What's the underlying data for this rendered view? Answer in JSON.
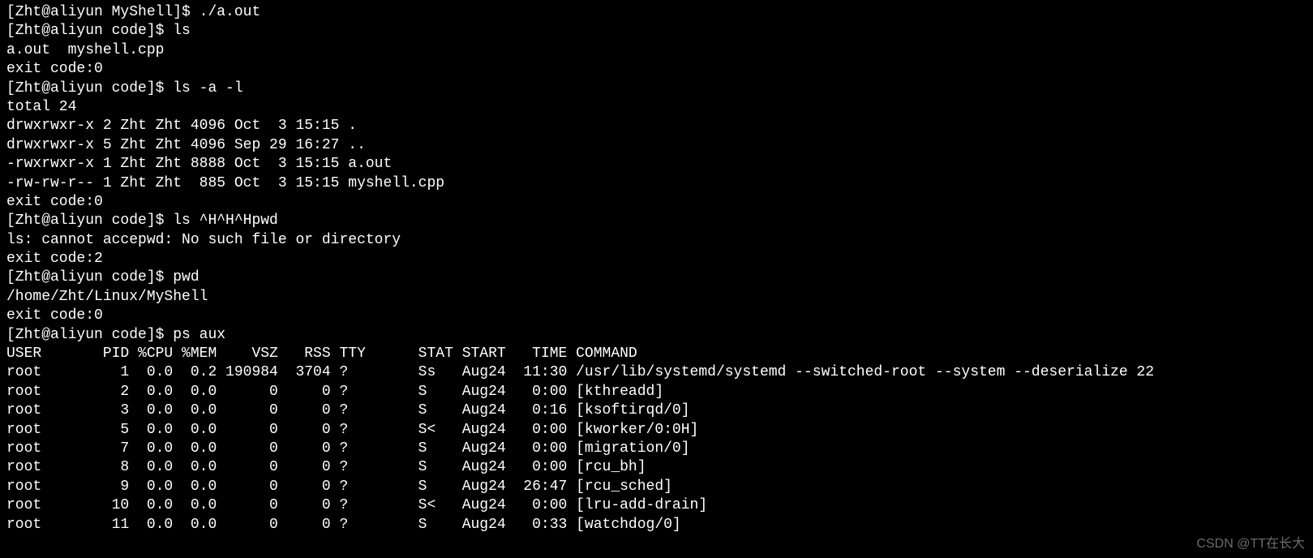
{
  "lines": [
    "[Zht@aliyun MyShell]$ ./a.out",
    "[Zht@aliyun code]$ ls",
    "a.out  myshell.cpp",
    "exit code:0",
    "[Zht@aliyun code]$ ls -a -l",
    "total 24",
    "drwxrwxr-x 2 Zht Zht 4096 Oct  3 15:15 .",
    "drwxrwxr-x 5 Zht Zht 4096 Sep 29 16:27 ..",
    "-rwxrwxr-x 1 Zht Zht 8888 Oct  3 15:15 a.out",
    "-rw-rw-r-- 1 Zht Zht  885 Oct  3 15:15 myshell.cpp",
    "exit code:0",
    "[Zht@aliyun code]$ ls ^H^H^Hpwd",
    "ls: cannot accepwd: No such file or directory",
    "exit code:2",
    "[Zht@aliyun code]$ pwd",
    "/home/Zht/Linux/MyShell",
    "exit code:0",
    "[Zht@aliyun code]$ ps aux",
    "USER       PID %CPU %MEM    VSZ   RSS TTY      STAT START   TIME COMMAND",
    "root         1  0.0  0.2 190984  3704 ?        Ss   Aug24  11:30 /usr/lib/systemd/systemd --switched-root --system --deserialize 22",
    "root         2  0.0  0.0      0     0 ?        S    Aug24   0:00 [kthreadd]",
    "root         3  0.0  0.0      0     0 ?        S    Aug24   0:16 [ksoftirqd/0]",
    "root         5  0.0  0.0      0     0 ?        S<   Aug24   0:00 [kworker/0:0H]",
    "root         7  0.0  0.0      0     0 ?        S    Aug24   0:00 [migration/0]",
    "root         8  0.0  0.0      0     0 ?        S    Aug24   0:00 [rcu_bh]",
    "root         9  0.0  0.0      0     0 ?        S    Aug24  26:47 [rcu_sched]",
    "root        10  0.0  0.0      0     0 ?        S<   Aug24   0:00 [lru-add-drain]",
    "root        11  0.0  0.0      0     0 ?        S    Aug24   0:33 [watchdog/0]"
  ],
  "watermark": "CSDN @TT在长大",
  "ps_data": {
    "headers": [
      "USER",
      "PID",
      "%CPU",
      "%MEM",
      "VSZ",
      "RSS",
      "TTY",
      "STAT",
      "START",
      "TIME",
      "COMMAND"
    ],
    "rows": [
      {
        "USER": "root",
        "PID": 1,
        "%CPU": 0.0,
        "%MEM": 0.2,
        "VSZ": 190984,
        "RSS": 3704,
        "TTY": "?",
        "STAT": "Ss",
        "START": "Aug24",
        "TIME": "11:30",
        "COMMAND": "/usr/lib/systemd/systemd --switched-root --system --deserialize 22"
      },
      {
        "USER": "root",
        "PID": 2,
        "%CPU": 0.0,
        "%MEM": 0.0,
        "VSZ": 0,
        "RSS": 0,
        "TTY": "?",
        "STAT": "S",
        "START": "Aug24",
        "TIME": "0:00",
        "COMMAND": "[kthreadd]"
      },
      {
        "USER": "root",
        "PID": 3,
        "%CPU": 0.0,
        "%MEM": 0.0,
        "VSZ": 0,
        "RSS": 0,
        "TTY": "?",
        "STAT": "S",
        "START": "Aug24",
        "TIME": "0:16",
        "COMMAND": "[ksoftirqd/0]"
      },
      {
        "USER": "root",
        "PID": 5,
        "%CPU": 0.0,
        "%MEM": 0.0,
        "VSZ": 0,
        "RSS": 0,
        "TTY": "?",
        "STAT": "S<",
        "START": "Aug24",
        "TIME": "0:00",
        "COMMAND": "[kworker/0:0H]"
      },
      {
        "USER": "root",
        "PID": 7,
        "%CPU": 0.0,
        "%MEM": 0.0,
        "VSZ": 0,
        "RSS": 0,
        "TTY": "?",
        "STAT": "S",
        "START": "Aug24",
        "TIME": "0:00",
        "COMMAND": "[migration/0]"
      },
      {
        "USER": "root",
        "PID": 8,
        "%CPU": 0.0,
        "%MEM": 0.0,
        "VSZ": 0,
        "RSS": 0,
        "TTY": "?",
        "STAT": "S",
        "START": "Aug24",
        "TIME": "0:00",
        "COMMAND": "[rcu_bh]"
      },
      {
        "USER": "root",
        "PID": 9,
        "%CPU": 0.0,
        "%MEM": 0.0,
        "VSZ": 0,
        "RSS": 0,
        "TTY": "?",
        "STAT": "S",
        "START": "Aug24",
        "TIME": "26:47",
        "COMMAND": "[rcu_sched]"
      },
      {
        "USER": "root",
        "PID": 10,
        "%CPU": 0.0,
        "%MEM": 0.0,
        "VSZ": 0,
        "RSS": 0,
        "TTY": "?",
        "STAT": "S<",
        "START": "Aug24",
        "TIME": "0:00",
        "COMMAND": "[lru-add-drain]"
      },
      {
        "USER": "root",
        "PID": 11,
        "%CPU": 0.0,
        "%MEM": 0.0,
        "VSZ": 0,
        "RSS": 0,
        "TTY": "?",
        "STAT": "S",
        "START": "Aug24",
        "TIME": "0:33",
        "COMMAND": "[watchdog/0]"
      }
    ]
  },
  "ls_data": {
    "total": 24,
    "entries": [
      {
        "perm": "drwxrwxr-x",
        "links": 2,
        "owner": "Zht",
        "group": "Zht",
        "size": 4096,
        "date": "Oct  3 15:15",
        "name": "."
      },
      {
        "perm": "drwxrwxr-x",
        "links": 5,
        "owner": "Zht",
        "group": "Zht",
        "size": 4096,
        "date": "Sep 29 16:27",
        "name": ".."
      },
      {
        "perm": "-rwxrwxr-x",
        "links": 1,
        "owner": "Zht",
        "group": "Zht",
        "size": 8888,
        "date": "Oct  3 15:15",
        "name": "a.out"
      },
      {
        "perm": "-rw-rw-r--",
        "links": 1,
        "owner": "Zht",
        "group": "Zht",
        "size": 885,
        "date": "Oct  3 15:15",
        "name": "myshell.cpp"
      }
    ]
  }
}
